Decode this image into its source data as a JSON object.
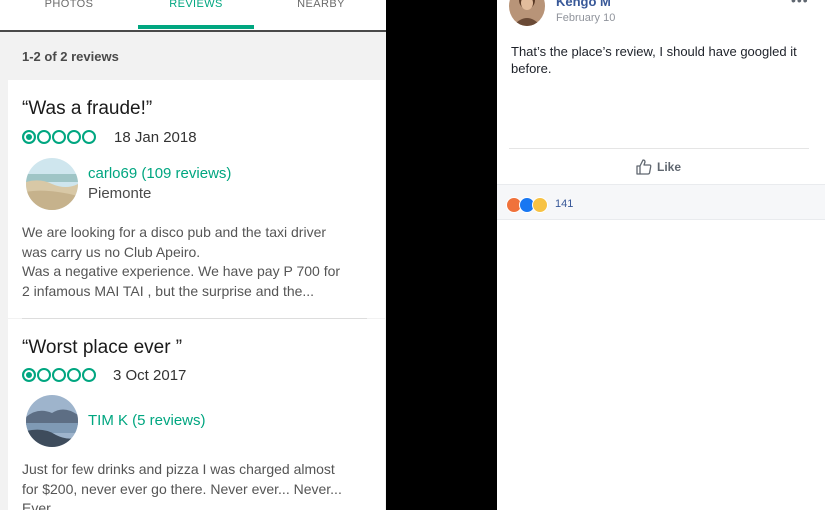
{
  "tabs": [
    {
      "label": "PHOTOS",
      "active": false
    },
    {
      "label": "REVIEWS",
      "active": true
    },
    {
      "label": "NEARBY",
      "active": false
    }
  ],
  "reviews_summary": "1-2 of 2 reviews",
  "colors": {
    "accent": "#00a680",
    "fb_link": "#385898"
  },
  "reviews": [
    {
      "title": "“Was a fraude!”",
      "rating": 1,
      "max_rating": 5,
      "date": "18 Jan 2018",
      "user": "carlo69 (109 reviews)",
      "location": "Piemonte",
      "body": [
        "We are looking for a disco pub and the taxi driver",
        "was carry us no Club Apeiro.",
        "Was a negative experience. We have pay P 700 for",
        "2 infamous MAI TAI , but the surprise and the..."
      ]
    },
    {
      "title": "“Worst place ever ”",
      "rating": 1,
      "max_rating": 5,
      "date": "3 Oct 2017",
      "user": "TIM K (5 reviews)",
      "location": "",
      "body": [
        "Just for few drinks and pizza I was charged almost",
        "for $200, never ever go there. Never ever... Never...",
        "Ever"
      ]
    }
  ],
  "post": {
    "author": "Kengo M",
    "date": "February 10",
    "text": "That’s the place’s review, I should have googled it before.",
    "like_label": "Like",
    "reactions": [
      "angry",
      "like",
      "sad"
    ],
    "reaction_count": "141"
  }
}
